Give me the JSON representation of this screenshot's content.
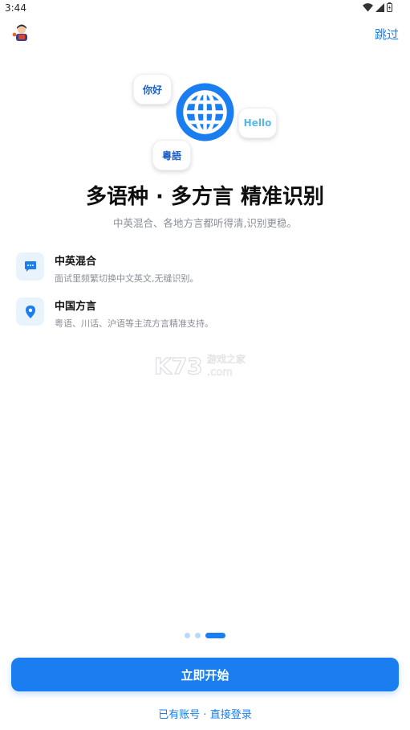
{
  "status_bar": {
    "time": "3:44",
    "icons": [
      "wifi-icon",
      "signal-icon",
      "battery-icon"
    ]
  },
  "header": {
    "logo_icon": "app-logo-icon",
    "skip_label": "跳过"
  },
  "hero": {
    "bubbles": {
      "mandarin": "你好",
      "english": "Hello",
      "cantonese": "粵語"
    },
    "center_icon": "globe-icon"
  },
  "headline": "多语种 · 多方言 精准识别",
  "subline": "中英混合、各地方言都听得清,识别更稳。",
  "features": [
    {
      "icon": "chat-bubble-icon",
      "title": "中英混合",
      "desc": "面试里频繁切换中文英文,无缝识别。"
    },
    {
      "icon": "location-pin-icon",
      "title": "中国方言",
      "desc": "粤语、川话、沪语等主流方言精准支持。"
    }
  ],
  "watermark": {
    "brand": "K73",
    "cn": "游戏之家",
    "domain": ".com"
  },
  "pager": {
    "pages": 3,
    "current": 3
  },
  "actions": {
    "start_label": "立即开始",
    "login_label": "已有账号 · 直接登录"
  },
  "colors": {
    "primary": "#1a7df0",
    "feature_bg": "#e8f3fc",
    "muted_text": "#8a8f98"
  }
}
